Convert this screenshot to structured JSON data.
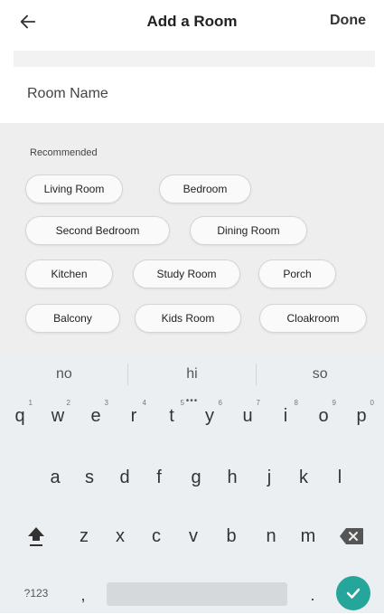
{
  "header": {
    "title": "Add a Room",
    "done_label": "Done"
  },
  "form": {
    "room_name_placeholder": "Room Name"
  },
  "recommended": {
    "label": "Recommended",
    "rooms": [
      "Living Room",
      "Bedroom",
      "Second Bedroom",
      "Dining Room",
      "Kitchen",
      "Study Room",
      "Porch",
      "Balcony",
      "Kids Room",
      "Cloakroom"
    ]
  },
  "keyboard": {
    "suggestions": [
      "no",
      "hi",
      "so"
    ],
    "row1": [
      "q",
      "w",
      "e",
      "r",
      "t",
      "y",
      "u",
      "i",
      "o",
      "p"
    ],
    "row1_hints": [
      "1",
      "2",
      "3",
      "4",
      "5",
      "6",
      "7",
      "8",
      "9",
      "0"
    ],
    "row2": [
      "a",
      "s",
      "d",
      "f",
      "g",
      "h",
      "j",
      "k",
      "l"
    ],
    "row3": [
      "z",
      "x",
      "c",
      "v",
      "b",
      "n",
      "m"
    ],
    "symbols_label": "?123",
    "comma_label": ",",
    "period_label": ".",
    "accent_color": "#26a69a"
  }
}
